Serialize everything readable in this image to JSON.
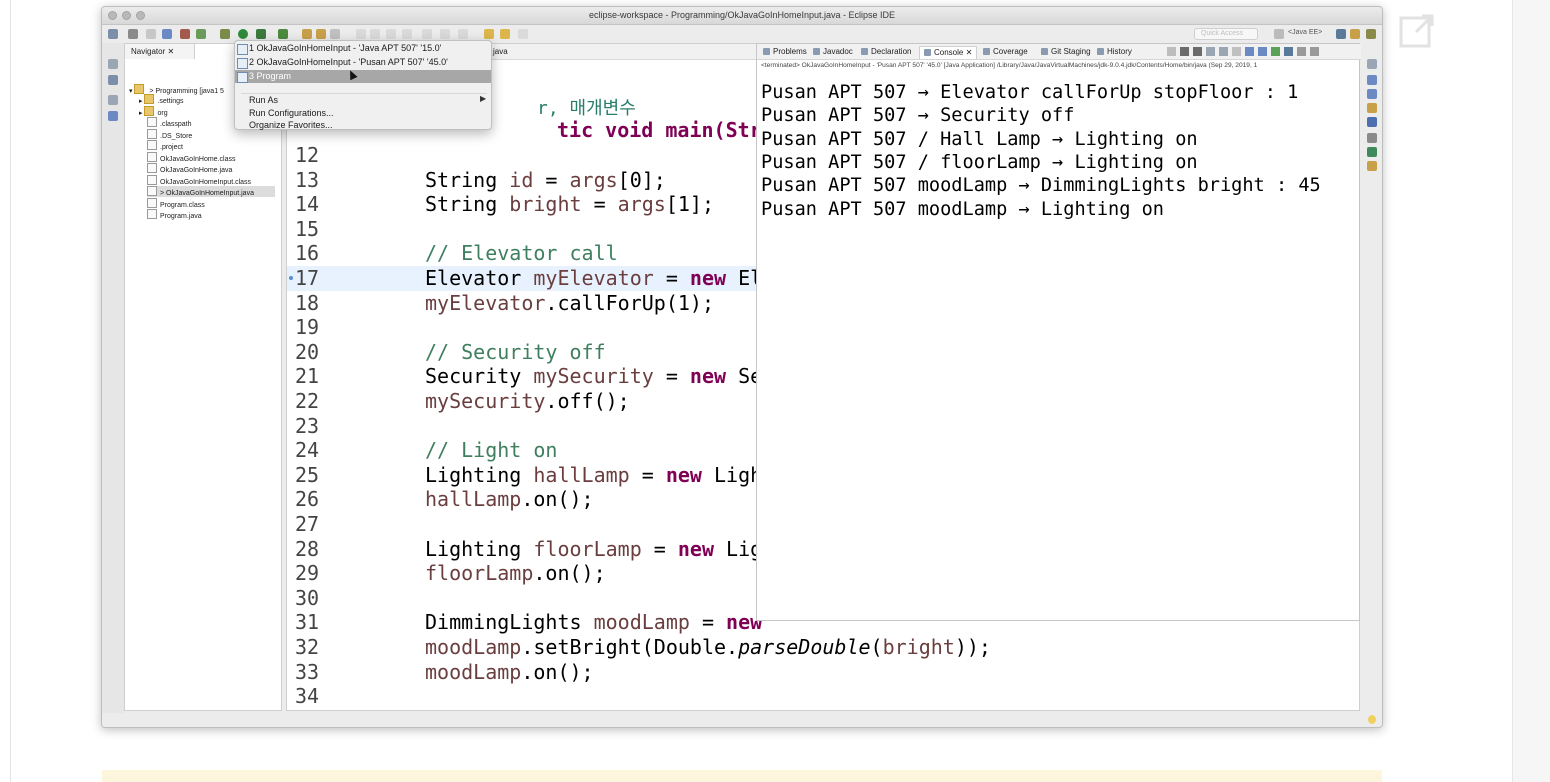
{
  "window": {
    "title": "eclipse-workspace - Programming/OkJavaGoInHomeInput.java - Eclipse IDE"
  },
  "toolbar": {
    "quick_access_placeholder": "Quick Access",
    "perspective_label": "<Java EE>"
  },
  "navigator": {
    "tab_label": "Navigator",
    "project_label": "> Programming [java1 5",
    "items": [
      {
        "label": ".settings",
        "icon": "folder-icon"
      },
      {
        "label": "org",
        "icon": "folder-icon"
      },
      {
        "label": ".classpath",
        "icon": "file-icon"
      },
      {
        "label": ".DS_Store",
        "icon": "file-icon"
      },
      {
        "label": ".project",
        "icon": "file-icon"
      },
      {
        "label": "OkJavaGoInHome.class",
        "icon": "class-file-icon"
      },
      {
        "label": "OkJavaGoInHome.java",
        "icon": "java-file-icon"
      },
      {
        "label": "OkJavaGoInHomeInput.class",
        "icon": "class-file-icon"
      },
      {
        "label": "> OkJavaGoInHomeInput.java",
        "icon": "java-file-icon"
      },
      {
        "label": "Program.class",
        "icon": "class-file-icon"
      },
      {
        "label": "Program.java",
        "icon": "java-file-icon"
      }
    ]
  },
  "run_menu": {
    "items": [
      {
        "label": "1 OkJavaGoInHomeInput - 'Java APT 507' '15.0'"
      },
      {
        "label": "2 OkJavaGoInHomeInput - 'Pusan APT 507' '45.0'"
      },
      {
        "label": "3 Program"
      }
    ],
    "run_as": "Run As",
    "run_configurations": "Run Configurations...",
    "organize_favorites": "Organize Favorites..."
  },
  "editor": {
    "tab_fragment": "java",
    "header_fragment_korean": "r, 매개변수",
    "header_fragment_code": "tic void main(String[]",
    "lines": [
      {
        "n": "12",
        "parts": []
      },
      {
        "n": "13",
        "parts": [
          {
            "t": "String "
          },
          {
            "t": "id",
            "c": "var"
          },
          {
            "t": " = "
          },
          {
            "t": "args",
            "c": "var"
          },
          {
            "t": "[0];"
          }
        ]
      },
      {
        "n": "14",
        "parts": [
          {
            "t": "String "
          },
          {
            "t": "bright",
            "c": "var"
          },
          {
            "t": " = "
          },
          {
            "t": "args",
            "c": "var"
          },
          {
            "t": "[1];"
          }
        ]
      },
      {
        "n": "15",
        "parts": []
      },
      {
        "n": "16",
        "parts": [
          {
            "t": "// Elevator call",
            "c": "cm"
          }
        ]
      },
      {
        "n": "17",
        "hl": true,
        "parts": [
          {
            "t": "Elevator "
          },
          {
            "t": "myElevator",
            "c": "var"
          },
          {
            "t": " = "
          },
          {
            "t": "new",
            "c": "kw"
          },
          {
            "t": " El"
          }
        ]
      },
      {
        "n": "18",
        "parts": [
          {
            "t": "myElevator",
            "c": "var"
          },
          {
            "t": ".callForUp(1);"
          }
        ]
      },
      {
        "n": "19",
        "parts": []
      },
      {
        "n": "20",
        "parts": [
          {
            "t": "// Security off",
            "c": "cm"
          }
        ]
      },
      {
        "n": "21",
        "parts": [
          {
            "t": "Security "
          },
          {
            "t": "mySecurity",
            "c": "var"
          },
          {
            "t": " = "
          },
          {
            "t": "new",
            "c": "kw"
          },
          {
            "t": " Se"
          }
        ]
      },
      {
        "n": "22",
        "parts": [
          {
            "t": "mySecurity",
            "c": "var"
          },
          {
            "t": ".off();"
          }
        ]
      },
      {
        "n": "23",
        "parts": []
      },
      {
        "n": "24",
        "parts": [
          {
            "t": "// Light on",
            "c": "cm"
          }
        ]
      },
      {
        "n": "25",
        "parts": [
          {
            "t": "Lighting "
          },
          {
            "t": "hallLamp",
            "c": "var"
          },
          {
            "t": " = "
          },
          {
            "t": "new",
            "c": "kw"
          },
          {
            "t": " Ligh"
          }
        ]
      },
      {
        "n": "26",
        "parts": [
          {
            "t": "hallLamp",
            "c": "var"
          },
          {
            "t": ".on();"
          }
        ]
      },
      {
        "n": "27",
        "parts": []
      },
      {
        "n": "28",
        "parts": [
          {
            "t": "Lighting "
          },
          {
            "t": "floorLamp",
            "c": "var"
          },
          {
            "t": " = "
          },
          {
            "t": "new",
            "c": "kw"
          },
          {
            "t": " Lig"
          }
        ]
      },
      {
        "n": "29",
        "parts": [
          {
            "t": "floorLamp",
            "c": "var"
          },
          {
            "t": ".on();"
          }
        ]
      },
      {
        "n": "30",
        "parts": []
      },
      {
        "n": "31",
        "parts": [
          {
            "t": "DimmingLights "
          },
          {
            "t": "moodLamp",
            "c": "var"
          },
          {
            "t": " = "
          },
          {
            "t": "new",
            "c": "kw"
          }
        ]
      },
      {
        "n": "32",
        "parts": [
          {
            "t": "moodLamp",
            "c": "var"
          },
          {
            "t": ".setBright(Double."
          },
          {
            "t": "parseDouble",
            "c": "it"
          },
          {
            "t": "("
          },
          {
            "t": "bright",
            "c": "var"
          },
          {
            "t": "));"
          }
        ]
      },
      {
        "n": "33",
        "parts": [
          {
            "t": "moodLamp",
            "c": "var"
          },
          {
            "t": ".on();"
          }
        ]
      },
      {
        "n": "34",
        "parts": []
      }
    ]
  },
  "console": {
    "tabs": [
      "Problems",
      "Javadoc",
      "Declaration",
      "Console",
      "Coverage",
      "Git Staging",
      "History"
    ],
    "active_tab": "Console",
    "status": "<terminated> OkJavaGoInHomeInput - 'Pusan APT 507' '45.0' [Java Application] /Library/Java/JavaVirtualMachines/jdk-9.0.4.jdk/Contents/Home/bin/java (Sep 29, 2019, 1",
    "output": [
      "Pusan APT 507 → Elevator callForUp stopFloor : 1",
      "Pusan APT 507 → Security off",
      "Pusan APT 507 / Hall Lamp → Lighting on",
      "Pusan APT 507 / floorLamp → Lighting on",
      "Pusan APT 507 moodLamp → DimmingLights bright : 45",
      "Pusan APT 507 moodLamp → Lighting on"
    ]
  }
}
